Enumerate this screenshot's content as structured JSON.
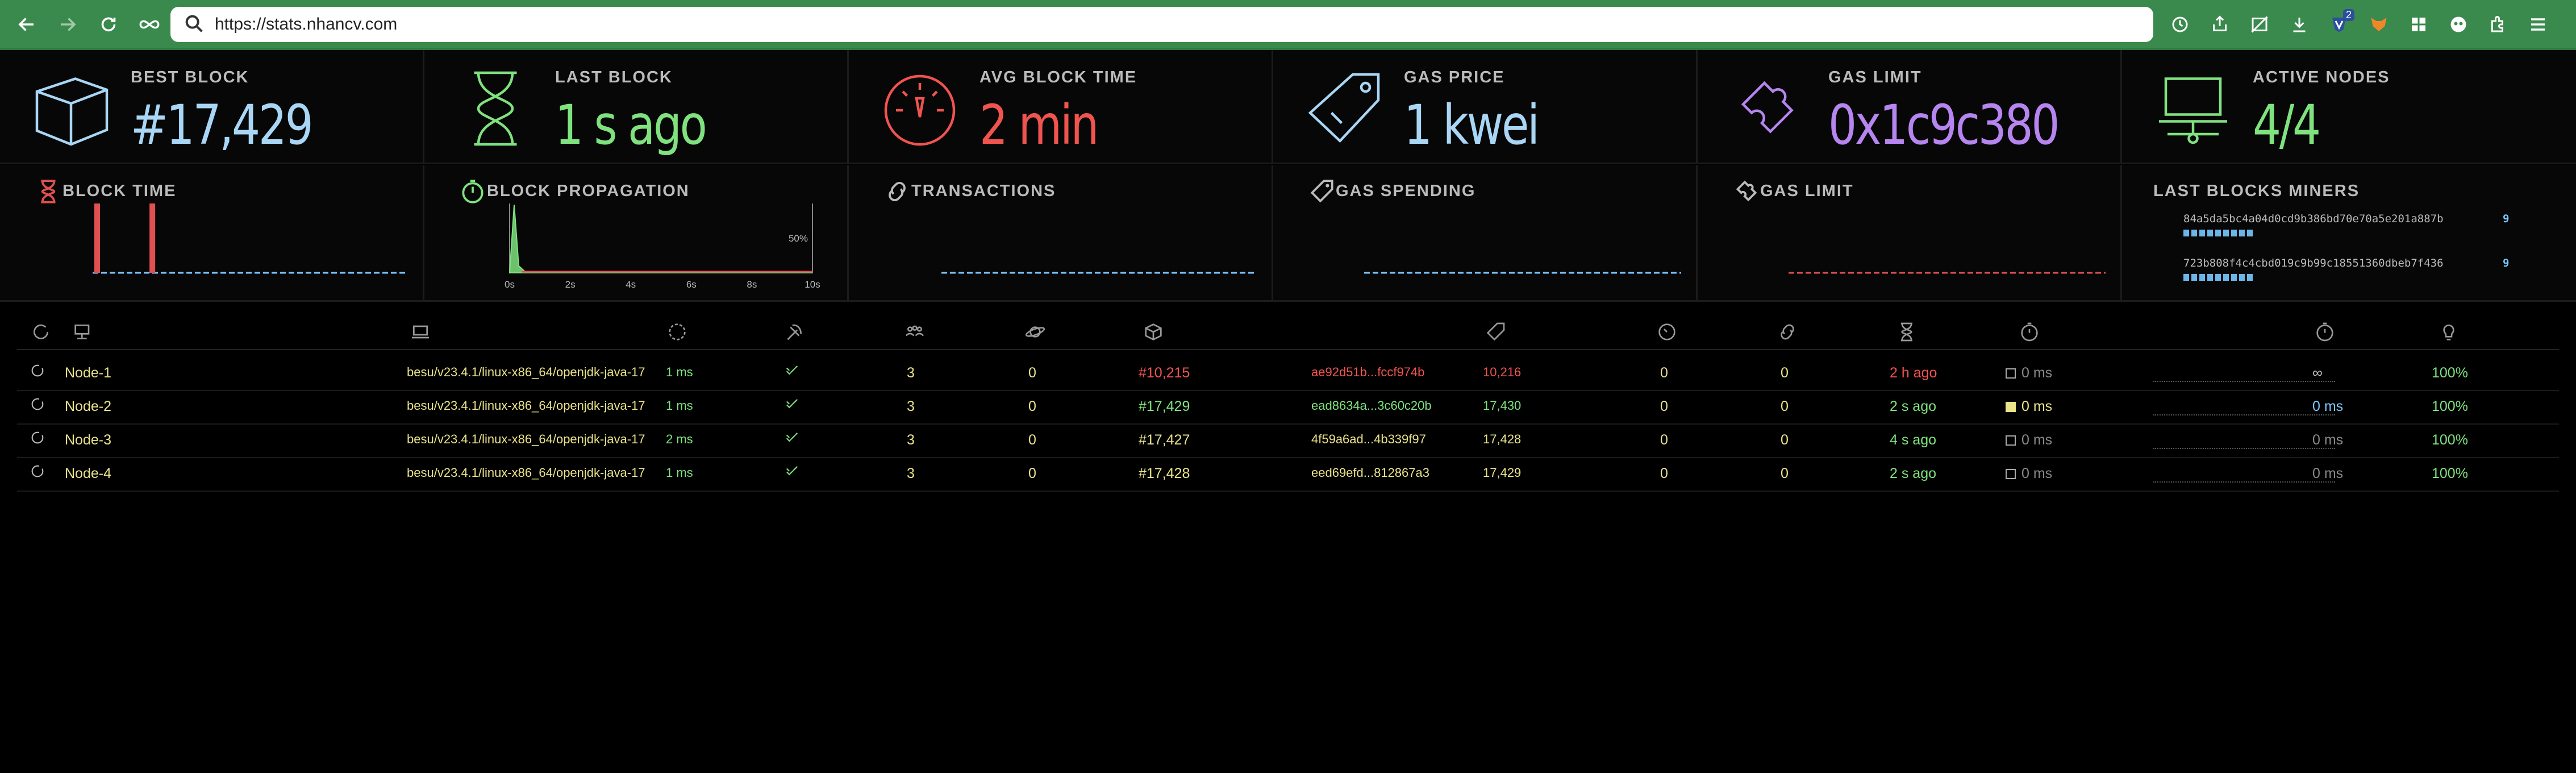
{
  "browser": {
    "url": "https://stats.nhancv.com",
    "extension_badge": "2"
  },
  "stats": [
    {
      "label": "BEST BLOCK",
      "value": "#17,429",
      "color": "#a9d6f5",
      "icon": "cube-icon"
    },
    {
      "label": "LAST BLOCK",
      "value": "1 s ago",
      "color": "#7fe27f",
      "icon": "hourglass-icon"
    },
    {
      "label": "AVG BLOCK TIME",
      "value": "2 min",
      "color": "#f0544f",
      "icon": "gauge-icon"
    },
    {
      "label": "GAS PRICE",
      "value": "1 kwei",
      "color": "#a9d6f5",
      "icon": "price-tag-icon"
    },
    {
      "label": "GAS LIMIT",
      "value": "0x1c9c380 gas",
      "color": "#b685f0",
      "icon": "puzzle-icon"
    },
    {
      "label": "ACTIVE NODES",
      "value": "4/4",
      "color": "#7fe27f",
      "icon": "laptop-network-icon"
    }
  ],
  "charts": {
    "block_time": {
      "label": "BLOCK TIME",
      "color": "#e05050",
      "icon": "hourglass-icon"
    },
    "block_propagation": {
      "label": "BLOCK PROPAGATION",
      "color": "#7fe27f",
      "icon": "stopwatch-icon",
      "tick_labels": [
        "0s",
        "2s",
        "4s",
        "6s",
        "8s",
        "10s"
      ],
      "y_label": "50%"
    },
    "transactions": {
      "label": "TRANSACTIONS",
      "color": "#7cc7ff",
      "icon": "link-icon"
    },
    "gas_spending": {
      "label": "GAS SPENDING",
      "color": "#7cc7ff",
      "icon": "price-tag-icon"
    },
    "gas_limit": {
      "label": "GAS LIMIT",
      "color": "#e05050",
      "icon": "puzzle-icon"
    },
    "miners": {
      "label": "LAST BLOCKS MINERS",
      "items": [
        {
          "address": "84a5da5bc4a04d0cd9b386bd70e70a5e201a887b",
          "count": "9"
        },
        {
          "address": "723b808f4c4cbd019c9b99c18551360dbeb7f436",
          "count": "9"
        }
      ]
    }
  },
  "chart_data": [
    {
      "type": "bar",
      "title": "BLOCK TIME",
      "values": [
        1,
        0,
        0,
        0,
        0,
        0,
        0,
        1,
        0,
        0,
        0,
        0,
        0,
        0,
        0,
        0,
        0,
        0,
        0,
        0,
        0,
        0,
        0,
        0,
        0,
        0,
        0,
        0,
        0,
        0,
        0,
        0,
        0,
        0,
        0,
        0,
        0,
        0,
        0,
        0
      ]
    },
    {
      "type": "area",
      "title": "BLOCK PROPAGATION",
      "x": [
        0,
        0.15,
        0.3,
        0.5,
        1,
        2,
        4,
        6,
        8,
        10
      ],
      "y": [
        0,
        98,
        10,
        2,
        0,
        0,
        0,
        0,
        0,
        0
      ],
      "xlabel": "",
      "ylabel": "",
      "yticks": [
        "50%"
      ],
      "xticks": [
        "0s",
        "2s",
        "4s",
        "6s",
        "8s",
        "10s"
      ]
    }
  ],
  "table": {
    "header_icons": [
      "refresh-icon",
      "node-icon",
      "laptop-icon",
      "timer-icon",
      "pickaxe-icon",
      "peers-icon",
      "planet-icon",
      "cube-icon",
      "",
      "price-tag-icon",
      "gauge-icon",
      "link-icon",
      "hourglass-icon",
      "stopwatch-icon",
      "",
      "stopwatch-icon",
      "bulb-icon"
    ],
    "rows": [
      {
        "name": "Node-1",
        "client": "besu/v23.4.1/linux-x86_64/openjdk-java-17",
        "latency": "1 ms",
        "peers": "3",
        "pending": "0",
        "block": "#10,215",
        "hash": "ae92d51b...fccf974b",
        "difficulty": "10,216",
        "txs": "0",
        "uncles": "0",
        "last_block": "2 h ago",
        "propagation": "0 ms",
        "avg_prop": "∞",
        "uptime": "100%",
        "color": "#f0544f",
        "hash_color": "#f0544f",
        "diff_color": "#f0544f",
        "last_color": "#f0544f",
        "prop_fill": false,
        "avg_color": "#bbb"
      },
      {
        "name": "Node-2",
        "client": "besu/v23.4.1/linux-x86_64/openjdk-java-17",
        "latency": "1 ms",
        "peers": "3",
        "pending": "0",
        "block": "#17,429",
        "hash": "ead8634a...3c60c20b",
        "difficulty": "17,430",
        "txs": "0",
        "uncles": "0",
        "last_block": "2 s ago",
        "propagation": "0 ms",
        "avg_prop": "0 ms",
        "uptime": "100%",
        "color": "#7fe27f",
        "hash_color": "#7fe27f",
        "diff_color": "#7fe27f",
        "last_color": "#7fe27f",
        "prop_fill": true,
        "avg_color": "#7cc7ff"
      },
      {
        "name": "Node-3",
        "client": "besu/v23.4.1/linux-x86_64/openjdk-java-17",
        "latency": "2 ms",
        "peers": "3",
        "pending": "0",
        "block": "#17,427",
        "hash": "4f59a6ad...4b339f97",
        "difficulty": "17,428",
        "txs": "0",
        "uncles": "0",
        "last_block": "4 s ago",
        "propagation": "0 ms",
        "avg_prop": "0 ms",
        "uptime": "100%",
        "color": "#e9e38a",
        "hash_color": "#e9e38a",
        "diff_color": "#e9e38a",
        "last_color": "#7fe27f",
        "prop_fill": false,
        "avg_color": "#888"
      },
      {
        "name": "Node-4",
        "client": "besu/v23.4.1/linux-x86_64/openjdk-java-17",
        "latency": "1 ms",
        "peers": "3",
        "pending": "0",
        "block": "#17,428",
        "hash": "eed69efd...812867a3",
        "difficulty": "17,429",
        "txs": "0",
        "uncles": "0",
        "last_block": "2 s ago",
        "propagation": "0 ms",
        "avg_prop": "0 ms",
        "uptime": "100%",
        "color": "#e9e38a",
        "hash_color": "#e9e38a",
        "diff_color": "#e9e38a",
        "last_color": "#7fe27f",
        "prop_fill": false,
        "avg_color": "#888"
      }
    ]
  }
}
